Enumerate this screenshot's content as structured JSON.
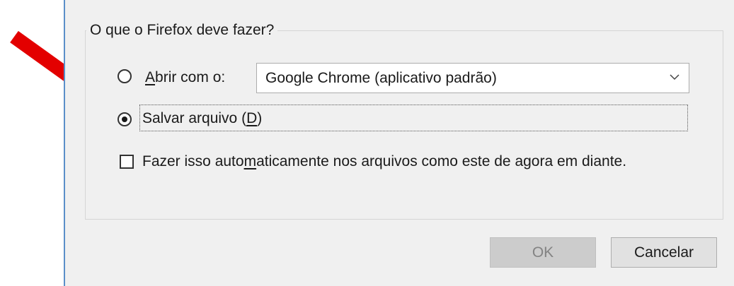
{
  "dialog": {
    "group_title": "O que o Firefox deve fazer?",
    "open_with": {
      "label_underlined": "A",
      "label_rest": "brir com o:",
      "selected_app": "Google Chrome (aplicativo padrão)"
    },
    "save_file": {
      "label_prefix": "Salvar arquivo (",
      "label_underlined": "D",
      "label_suffix": ")"
    },
    "auto_checkbox": {
      "label_prefix": "Fazer isso auto",
      "label_underlined": "m",
      "label_suffix": "aticamente nos arquivos como este de agora em diante."
    },
    "buttons": {
      "ok": "OK",
      "cancel": "Cancelar"
    }
  },
  "colors": {
    "arrow": "#e30000",
    "dialog_bg": "#f0f0f0",
    "window_border": "#5a8fc9"
  },
  "icons": {
    "annotation": "red-arrow-icon",
    "dropdown": "chevron-down-icon"
  }
}
